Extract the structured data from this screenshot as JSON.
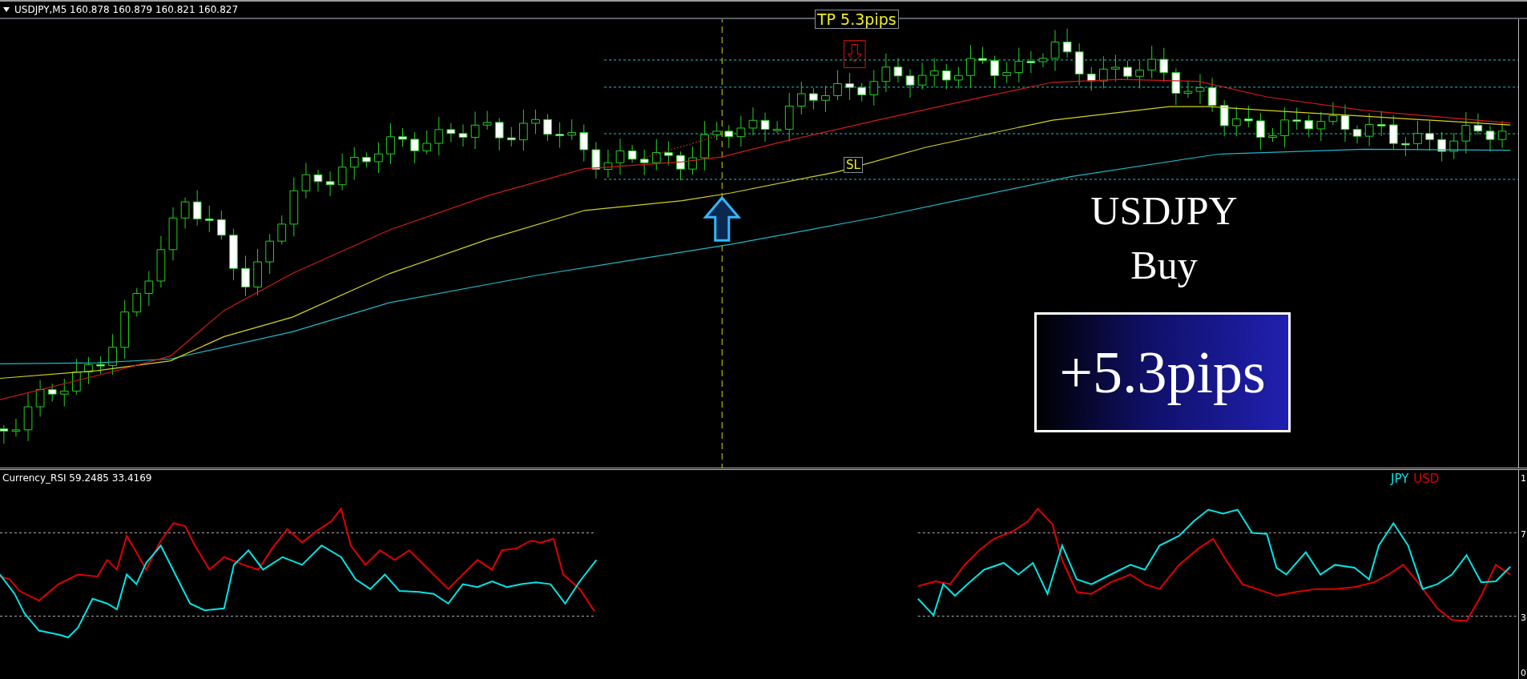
{
  "header": {
    "symbol_line": "USDJPY,M5  160.878 160.879 160.821 160.827"
  },
  "chart": {
    "tp_label": "TP 5.3pips",
    "sl_label": "SL"
  },
  "signal": {
    "pair": "USDJPY",
    "direction": "Buy",
    "result": "+5.3pips"
  },
  "indicator": {
    "title": "Currency_RSI 59.2485 33.4169",
    "legend": [
      {
        "label": "JPY",
        "color": "#00e5e5"
      },
      {
        "label": "USD",
        "color": "#e00000"
      }
    ],
    "axis_labels": [
      "1",
      "7",
      "3",
      "0"
    ]
  }
}
